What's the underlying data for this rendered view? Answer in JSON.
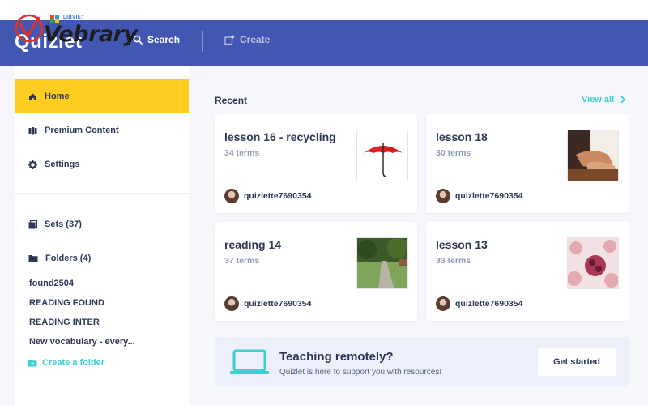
{
  "watermark": {
    "text": "Vebrary",
    "small_text": "LIBVIET"
  },
  "header": {
    "brand": "Quizlet",
    "search_label": "Search",
    "create_label": "Create"
  },
  "sidebar": {
    "items": [
      {
        "label": "Home",
        "icon": "home-icon",
        "active": true
      },
      {
        "label": "Premium Content",
        "icon": "library-icon"
      },
      {
        "label": "Settings",
        "icon": "gear-icon"
      },
      {
        "label": "Sets (37)",
        "icon": "sets-icon"
      },
      {
        "label": "Folders (4)",
        "icon": "folder-icon"
      }
    ],
    "folders": [
      "found2504",
      "READING FOUND",
      "READING INTER",
      "New vocabulary - every..."
    ],
    "create_folder_label": "Create a folder"
  },
  "main": {
    "recent_title": "Recent",
    "view_all_label": "View all",
    "cards": [
      {
        "title": "lesson 16 - recycling",
        "terms": "34 terms",
        "user": "quizlette7690354",
        "thumb": "umbrella-image"
      },
      {
        "title": "lesson 18",
        "terms": "30 terms",
        "user": "quizlette7690354",
        "thumb": "hands-image"
      },
      {
        "title": "reading 14",
        "terms": "37 terms",
        "user": "quizlette7690354",
        "thumb": "street-image"
      },
      {
        "title": "lesson 13",
        "terms": "33 terms",
        "user": "quizlette7690354",
        "thumb": "cells-image"
      }
    ],
    "banner": {
      "title": "Teaching remotely?",
      "subtitle": "Quizlet is here to support you with resources!",
      "button_label": "Get started"
    }
  },
  "colors": {
    "header": "#4257b2",
    "active_item": "#ffcd1f",
    "accent": "#3ccfcf",
    "text": "#2e3856",
    "muted": "#939bb4"
  }
}
